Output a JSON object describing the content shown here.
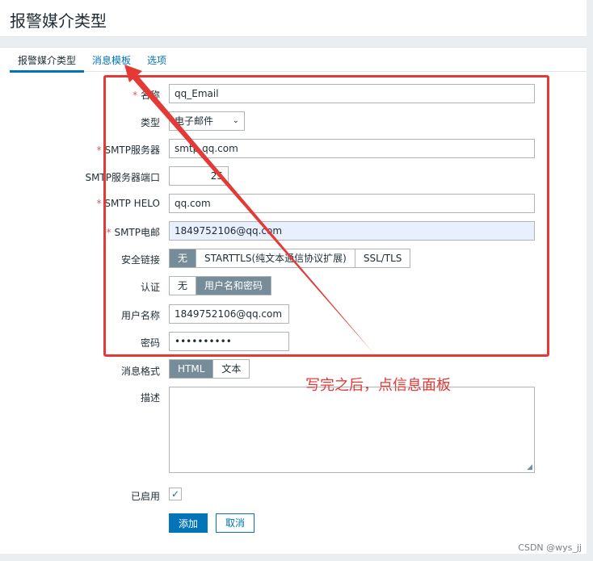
{
  "header": {
    "title": "报警媒介类型"
  },
  "tabs": [
    {
      "label": "报警媒介类型",
      "active": true
    },
    {
      "label": "消息模板",
      "active": false
    },
    {
      "label": "选项",
      "active": false
    }
  ],
  "form": {
    "name": {
      "label": "名称",
      "value": "qq_Email",
      "required": true
    },
    "type": {
      "label": "类型",
      "value": "电子邮件"
    },
    "smtp_server": {
      "label": "SMTP服务器",
      "value": "smtp.qq.com",
      "required": true
    },
    "smtp_port": {
      "label": "SMTP服务器端口",
      "value": "25"
    },
    "smtp_helo": {
      "label": "SMTP HELO",
      "value": "qq.com",
      "required": true
    },
    "smtp_email": {
      "label": "SMTP电邮",
      "value": "1849752106@qq.com",
      "required": true
    },
    "security": {
      "label": "安全链接",
      "options": [
        "无",
        "STARTTLS(纯文本通信协议扩展)",
        "SSL/TLS"
      ],
      "selected": "无"
    },
    "auth": {
      "label": "认证",
      "options": [
        "无",
        "用户名和密码"
      ],
      "selected": "用户名和密码"
    },
    "username": {
      "label": "用户名称",
      "value": "1849752106@qq.com"
    },
    "password": {
      "label": "密码",
      "value": "••••••••••"
    },
    "message_format": {
      "label": "消息格式",
      "options": [
        "HTML",
        "文本"
      ],
      "selected": "HTML"
    },
    "description": {
      "label": "描述",
      "value": ""
    },
    "enabled": {
      "label": "已启用",
      "checked": true
    }
  },
  "buttons": {
    "add": "添加",
    "cancel": "取消"
  },
  "annotation": {
    "text": "写完之后，点信息面板",
    "color": "#e53935"
  },
  "watermark": "CSDN @wys_jj",
  "icons": {
    "checkmark": "✓",
    "chevron": "⌄",
    "resize": "◢"
  },
  "colors": {
    "accent": "#0275b8",
    "segment_on": "#768d99",
    "annotation": "#e53935",
    "required": "#e45959"
  }
}
